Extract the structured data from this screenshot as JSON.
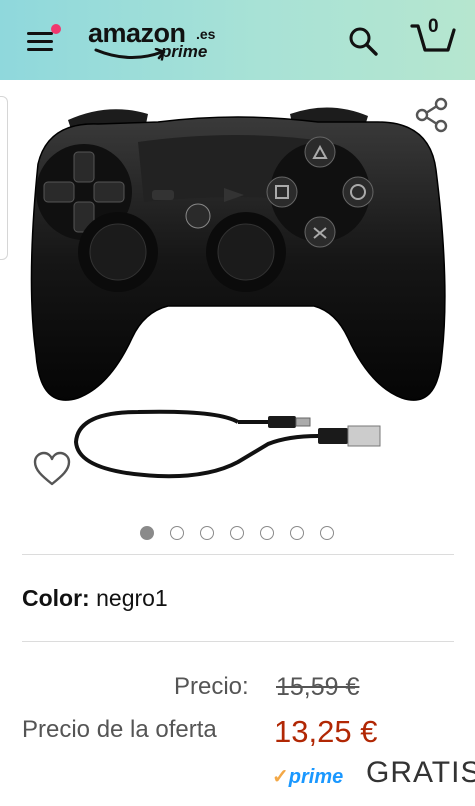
{
  "header": {
    "logo_word": "amazon",
    "logo_tld": ".es",
    "logo_prime": "prime",
    "cart_count": "0"
  },
  "icons": {
    "menu": "hamburger-menu-icon",
    "notification": "notification-dot-icon",
    "search": "search-icon",
    "cart": "cart-icon",
    "share": "share-icon",
    "wishlist": "heart-outline-icon"
  },
  "gallery": {
    "image_count": 7,
    "active_index": 0
  },
  "product": {
    "color_label": "Color:",
    "color_value": "negro1"
  },
  "pricing": {
    "price_label": "Precio:",
    "price_old": "15,59 €",
    "offer_label": "Precio de la oferta",
    "price_new": "13,25 €"
  },
  "delivery": {
    "prime_check": "✓",
    "prime_label": "prime",
    "shipping_text": "GRATIS"
  },
  "colors": {
    "header_gradient_start": "#8fd8dc",
    "header_gradient_end": "#b6e6cf",
    "notification_dot": "#f0386e",
    "offer_price": "#b12704",
    "prime_blue": "#1a98ff",
    "prime_check": "#f3a847"
  }
}
